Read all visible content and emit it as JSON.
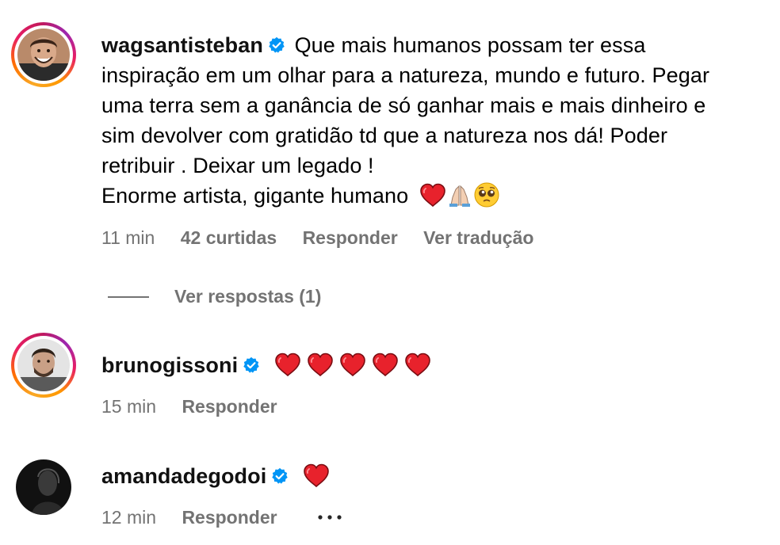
{
  "comments": [
    {
      "username": "wagsantisteban",
      "text_lines": [
        "Que mais humanos possam ter essa",
        "inspiração em um olhar para a natureza, mundo e futuro. Pegar",
        "uma terra sem a ganância de só ganhar mais e mais dinheiro e",
        "sim devolver com gratidão td que a natureza nos dá! Poder",
        "retribuir . Deixar um legado !",
        "Enorme artista, gigante humano"
      ],
      "time": "11 min",
      "likes": "42 curtidas",
      "reply_label": "Responder",
      "translate_label": "Ver tradução",
      "view_replies": "Ver respostas (1)",
      "emojis": [
        "red-heart",
        "folded-hands",
        "pleading-face"
      ]
    },
    {
      "username": "brunogissoni",
      "time": "15 min",
      "reply_label": "Responder",
      "emojis": [
        "red-heart",
        "red-heart",
        "red-heart",
        "red-heart",
        "red-heart"
      ]
    },
    {
      "username": "amandadegodoi",
      "time": "12 min",
      "reply_label": "Responder",
      "more_label": "•••",
      "emojis": [
        "red-heart"
      ]
    }
  ],
  "colors": {
    "verified_blue": "#0095f6",
    "meta_gray": "#737373",
    "heart_red": "#e8222c"
  }
}
